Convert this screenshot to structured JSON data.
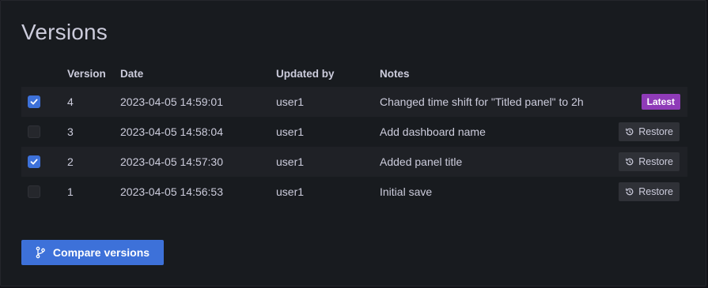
{
  "title": "Versions",
  "columns": {
    "version": "Version",
    "date": "Date",
    "updated_by": "Updated by",
    "notes": "Notes"
  },
  "rows": [
    {
      "checked": true,
      "version": "4",
      "date": "2023-04-05 14:59:01",
      "user": "user1",
      "notes": "Changed time shift for \"Titled panel\" to 2h",
      "badge": "Latest"
    },
    {
      "checked": false,
      "version": "3",
      "date": "2023-04-05 14:58:04",
      "user": "user1",
      "notes": "Add dashboard name",
      "action": "Restore"
    },
    {
      "checked": true,
      "version": "2",
      "date": "2023-04-05 14:57:30",
      "user": "user1",
      "notes": "Added panel title",
      "action": "Restore"
    },
    {
      "checked": false,
      "version": "1",
      "date": "2023-04-05 14:56:53",
      "user": "user1",
      "notes": "Initial save",
      "action": "Restore"
    }
  ],
  "compare_button": {
    "label": "Compare versions",
    "icon": "code-branch-icon"
  },
  "colors": {
    "primary": "#3d71d9",
    "latest_badge": "#8f3bb8",
    "background": "#181b1f"
  }
}
